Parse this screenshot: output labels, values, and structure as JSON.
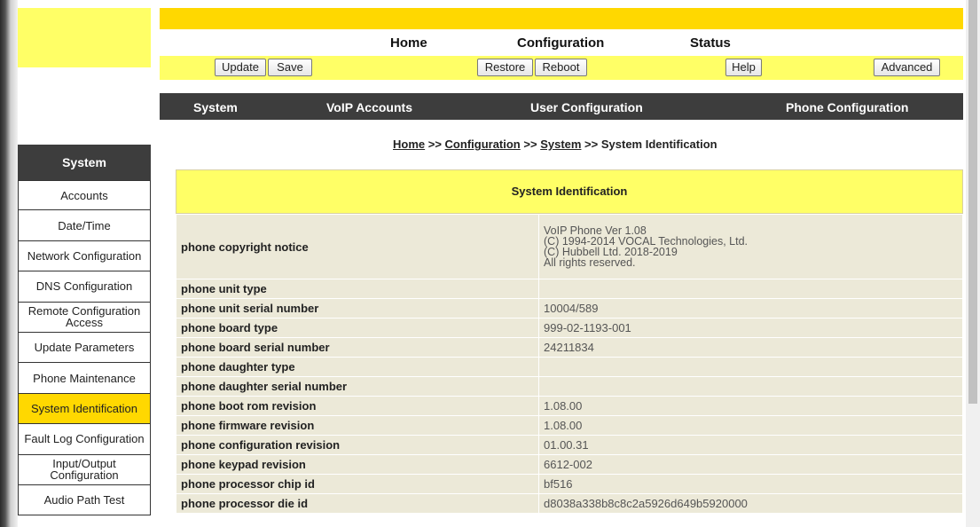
{
  "top_nav": {
    "home": "Home",
    "configuration": "Configuration",
    "status": "Status"
  },
  "buttons": {
    "update": "Update",
    "save": "Save",
    "restore": "Restore",
    "reboot": "Reboot",
    "help": "Help",
    "advanced": "Advanced"
  },
  "tabs": {
    "system": "System",
    "voip_accounts": "VoIP Accounts",
    "user_configuration": "User Configuration",
    "phone_configuration": "Phone Configuration"
  },
  "breadcrumb": {
    "home": "Home",
    "sep1": " >> ",
    "configuration": "Configuration",
    "sep2": " >> ",
    "system": "System",
    "sep3": " >> ",
    "current": "System Identification"
  },
  "sidebar": {
    "title": "System",
    "items": [
      {
        "label": "Accounts"
      },
      {
        "label": "Date/Time"
      },
      {
        "label": "Network Configuration"
      },
      {
        "label": "DNS Configuration"
      },
      {
        "label": "Remote Configuration Access"
      },
      {
        "label": "Update Parameters"
      },
      {
        "label": "Phone Maintenance"
      },
      {
        "label": "System Identification"
      },
      {
        "label": "Fault Log Configuration"
      },
      {
        "label": "Input/Output Configuration"
      },
      {
        "label": "Audio Path Test"
      }
    ]
  },
  "table": {
    "title": "System Identification",
    "copyright": {
      "label": "phone copyright notice",
      "lines": [
        "VoIP Phone Ver 1.08",
        "(C) 1994-2014 VOCAL Technologies, Ltd.",
        "(C) Hubbell Ltd. 2018-2019",
        "All rights reserved."
      ]
    },
    "rows": [
      {
        "label": "phone unit type",
        "value": ""
      },
      {
        "label": "phone unit serial number",
        "value": "10004/589"
      },
      {
        "label": "phone board type",
        "value": "999-02-1193-001"
      },
      {
        "label": "phone board serial number",
        "value": "24211834"
      },
      {
        "label": "phone daughter type",
        "value": ""
      },
      {
        "label": "phone daughter serial number",
        "value": ""
      },
      {
        "label": "phone boot rom revision",
        "value": "1.08.00"
      },
      {
        "label": "phone firmware revision",
        "value": "1.08.00"
      },
      {
        "label": "phone configuration revision",
        "value": "01.00.31"
      },
      {
        "label": "phone keypad revision",
        "value": "6612-002"
      },
      {
        "label": "phone processor chip id",
        "value": "bf516"
      },
      {
        "label": "phone processor die id",
        "value": "d8038a338b8c8c2a5926d649b5920000"
      }
    ]
  },
  "colors": {
    "yellow_bright": "#ffd800",
    "yellow_light": "#ffff66",
    "dark_bar": "#3d3d3d",
    "row_bg": "#ece9d8"
  }
}
